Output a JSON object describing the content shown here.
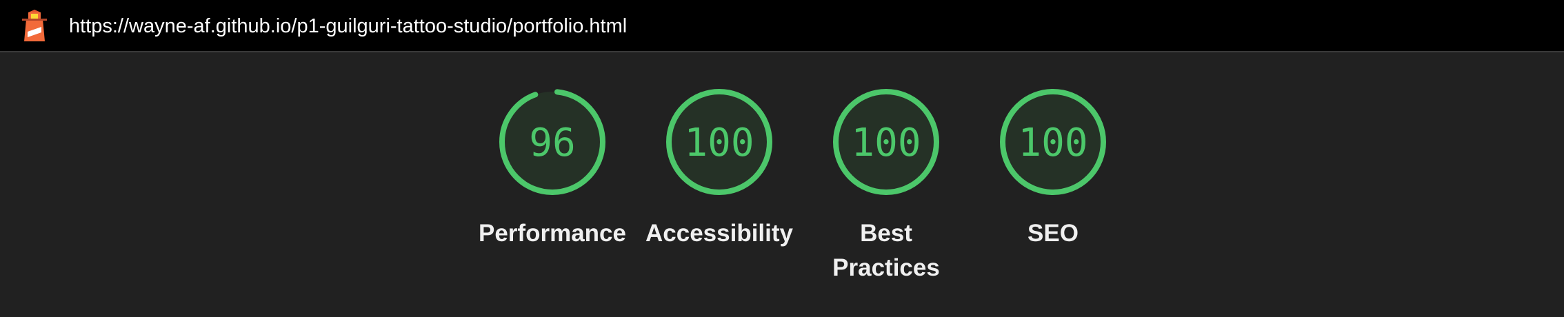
{
  "header": {
    "url": "https://wayne-af.github.io/p1-guilguri-tattoo-studio/portfolio.html",
    "logo_icon": "lighthouse-icon"
  },
  "colors": {
    "background": "#212121",
    "topbar": "#000000",
    "pass": "#4cc76a",
    "pass_fill": "#253126"
  },
  "categories": [
    {
      "label": "Performance",
      "score": 96,
      "score_text": "96"
    },
    {
      "label": "Accessibility",
      "score": 100,
      "score_text": "100"
    },
    {
      "label": "Best Practices",
      "score": 100,
      "score_text": "100"
    },
    {
      "label": "SEO",
      "score": 100,
      "score_text": "100"
    }
  ]
}
